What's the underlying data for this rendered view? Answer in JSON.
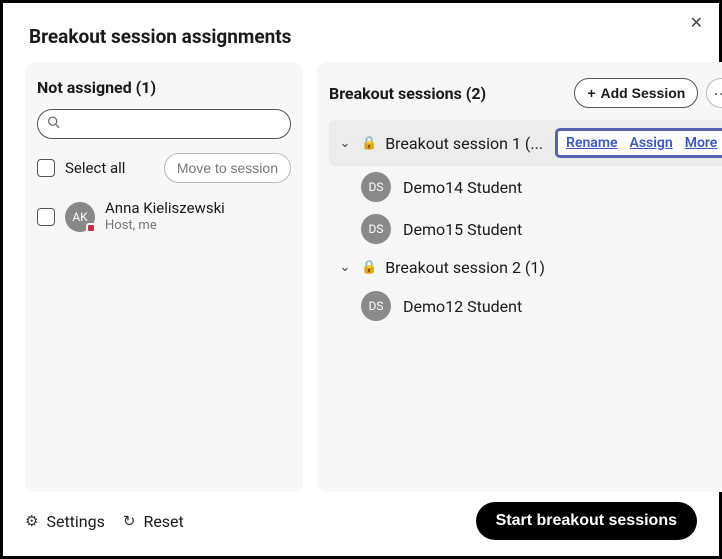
{
  "title": "Breakout session assignments",
  "not_assigned": {
    "header": "Not assigned (1)",
    "select_all": "Select all",
    "move_btn": "Move to session",
    "people": [
      {
        "initials": "AK",
        "name": "Anna Kieliszewski",
        "sub": "Host, me"
      }
    ]
  },
  "breakout": {
    "header": "Breakout sessions  (2)",
    "add_session": "Add Session",
    "sessions": [
      {
        "name_display": "Breakout session 1 (...",
        "selected": true,
        "members": [
          {
            "initials": "DS",
            "name": "Demo14 Student"
          },
          {
            "initials": "DS",
            "name": "Demo15 Student"
          }
        ]
      },
      {
        "name_display": "Breakout session 2 (1)",
        "selected": false,
        "members": [
          {
            "initials": "DS",
            "name": "Demo12 Student"
          }
        ]
      }
    ],
    "actions": {
      "rename": "Rename",
      "assign": "Assign",
      "more": "More"
    }
  },
  "footer": {
    "settings": "Settings",
    "reset": "Reset",
    "start": "Start breakout sessions"
  }
}
